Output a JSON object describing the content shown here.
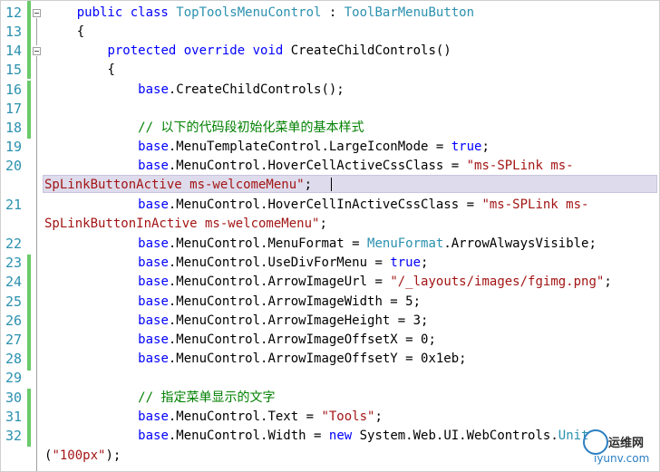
{
  "lines": {
    "l12": {
      "n": "12",
      "t1": "public class ",
      "t2": "TopToolsMenuControl",
      "t3": " : ",
      "t4": "ToolBarMenuButton"
    },
    "l13": {
      "n": "13",
      "t1": "{"
    },
    "l14": {
      "n": "14",
      "t1": "protected override void ",
      "t2": "CreateChildControls()"
    },
    "l15": {
      "n": "15",
      "t1": "{"
    },
    "l16": {
      "n": "16",
      "t1": "base",
      "t2": ".CreateChildControls();"
    },
    "l17": {
      "n": "17"
    },
    "l18": {
      "n": "18",
      "t1": "// 以下的代码段初始化菜单的基本样式"
    },
    "l19": {
      "n": "19",
      "t1": "base",
      "t2": ".MenuTemplateControl.LargeIconMode = ",
      "t3": "true",
      "t4": ";"
    },
    "l20": {
      "n": "20",
      "t1": "base",
      "t2": ".MenuControl.HoverCellActiveCssClass = ",
      "t3": "\"ms-SPLink ms-",
      "w1": "SpLinkButtonActive ms-welcomeMenu\"",
      "w2": ";"
    },
    "l21": {
      "n": "21",
      "t1": "base",
      "t2": ".MenuControl.HoverCellInActiveCssClass = ",
      "t3": "\"ms-SPLink ms-",
      "w1": "SpLinkButtonInActive ms-welcomeMenu\"",
      "w2": ";"
    },
    "l22": {
      "n": "22",
      "t1": "base",
      "t2": ".MenuControl.MenuFormat = ",
      "t3": "MenuFormat",
      "t4": ".ArrowAlwaysVisible;"
    },
    "l23": {
      "n": "23",
      "t1": "base",
      "t2": ".MenuControl.UseDivForMenu = ",
      "t3": "true",
      "t4": ";"
    },
    "l24": {
      "n": "24",
      "t1": "base",
      "t2": ".MenuControl.ArrowImageUrl = ",
      "t3": "\"/_layouts/images/fgimg.png\"",
      "t4": ";"
    },
    "l25": {
      "n": "25",
      "t1": "base",
      "t2": ".MenuControl.ArrowImageWidth = 5;"
    },
    "l26": {
      "n": "26",
      "t1": "base",
      "t2": ".MenuControl.ArrowImageHeight = 3;"
    },
    "l27": {
      "n": "27",
      "t1": "base",
      "t2": ".MenuControl.ArrowImageOffsetX = 0;"
    },
    "l28": {
      "n": "28",
      "t1": "base",
      "t2": ".MenuControl.ArrowImageOffsetY = 0x1eb;"
    },
    "l29": {
      "n": "29"
    },
    "l30": {
      "n": "30",
      "t1": "// 指定菜单显示的文字"
    },
    "l31": {
      "n": "31",
      "t1": "base",
      "t2": ".MenuControl.Text = ",
      "t3": "\"Tools\"",
      "t4": ";"
    },
    "l32": {
      "n": "32",
      "t1": "base",
      "t2": ".MenuControl.Width = ",
      "t3": "new ",
      "t4": "System.Web.UI.WebControls.",
      "t5": "Unit",
      "w1": "(",
      "w2": "\"100px\"",
      "w3": ");"
    }
  },
  "watermark": {
    "title": "运维网",
    "url": "iyunv.com"
  },
  "colors": {
    "keyword": "#0000ff",
    "type": "#2b91af",
    "string": "#a31515",
    "comment": "#008000",
    "line_number": "#2b91af",
    "change_bar": "#6ac96a",
    "current_line": "#dedcec"
  }
}
